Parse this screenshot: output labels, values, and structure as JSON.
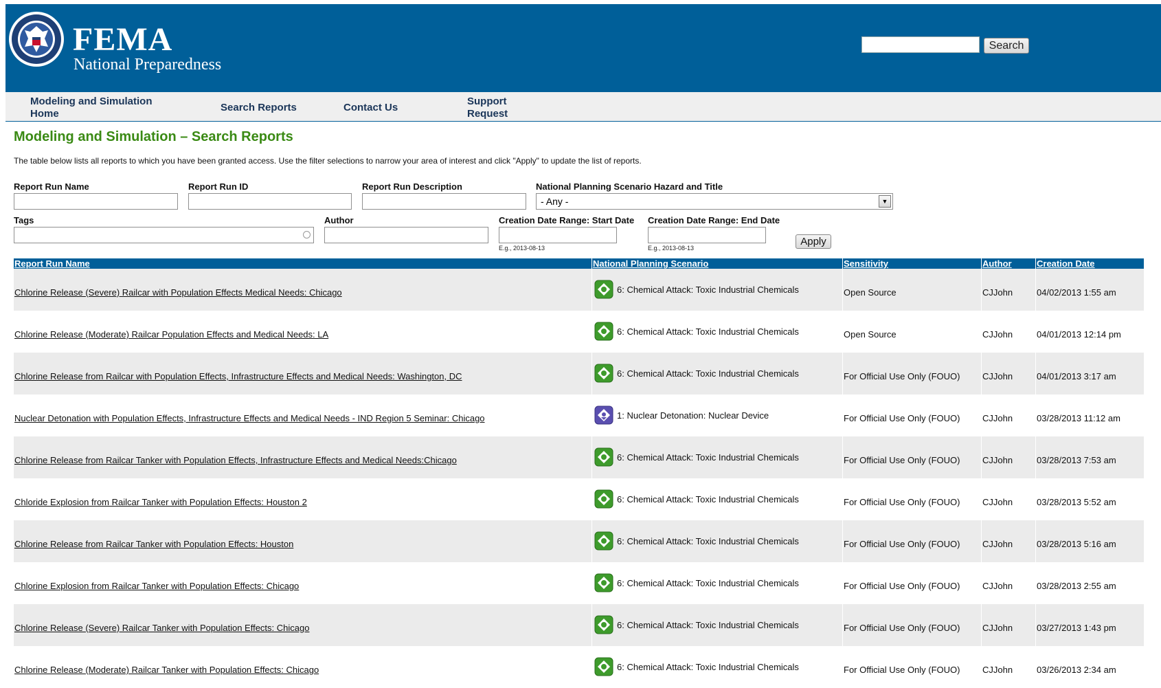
{
  "header": {
    "logo_title": "FEMA",
    "logo_subtitle": "National Preparedness",
    "search_button": "Search",
    "search_value": ""
  },
  "nav": {
    "items": [
      {
        "label": "Modeling and Simulation Home"
      },
      {
        "label": "Search Reports"
      },
      {
        "label": "Contact Us"
      },
      {
        "label": "Support Request"
      }
    ]
  },
  "page": {
    "title": "Modeling and Simulation – Search Reports",
    "intro": "The table below lists all reports to which you have been granted access. Use the filter selections to narrow your area of interest and click \"Apply\" to update the list of reports."
  },
  "filters": {
    "report_run_name": "Report Run Name",
    "report_run_id": "Report Run ID",
    "report_run_description": "Report Run Description",
    "hazard_label": "National Planning Scenario Hazard and Title",
    "hazard_selected": "- Any -",
    "tags": "Tags",
    "author": "Author",
    "start_date": "Creation Date Range: Start Date",
    "end_date": "Creation Date Range: End Date",
    "date_hint": "E.g., 2013-08-13",
    "apply": "Apply"
  },
  "colors": {
    "header_blue": "#005f99",
    "title_green": "#3a8a14",
    "chemical_icon": "#3e9b2c",
    "nuclear_icon": "#5a4fb0"
  },
  "table": {
    "headers": [
      "Report Run Name",
      "National Planning Scenario",
      "Sensitivity",
      "Author",
      "Creation Date"
    ],
    "rows": [
      {
        "name": "Chlorine Release (Severe) Railcar with Population Effects Medical Needs: Chicago",
        "icon": "chemical-hazard-icon",
        "scenario": "6: Chemical Attack: Toxic Industrial Chemicals",
        "sensitivity": "Open Source",
        "author": "CJJohn",
        "date": "04/02/2013 1:55 am"
      },
      {
        "name": "Chlorine Release (Moderate) Railcar Population Effects and Medical Needs: LA",
        "icon": "chemical-hazard-icon",
        "scenario": "6: Chemical Attack: Toxic Industrial Chemicals",
        "sensitivity": "Open Source",
        "author": "CJJohn",
        "date": "04/01/2013 12:14 pm"
      },
      {
        "name": "Chlorine Release from Railcar with Population Effects, Infrastructure Effects and Medical Needs: Washington, DC",
        "icon": "chemical-hazard-icon",
        "scenario": "6: Chemical Attack: Toxic Industrial Chemicals",
        "sensitivity": "For Official Use Only (FOUO)",
        "author": "CJJohn",
        "date": "04/01/2013 3:17 am"
      },
      {
        "name": "Nuclear Detonation with Population Effects, Infrastructure Effects and Medical Needs - IND Region 5 Seminar: Chicago",
        "icon": "nuclear-hazard-icon",
        "scenario": "1: Nuclear Detonation: Nuclear Device",
        "sensitivity": "For Official Use Only (FOUO)",
        "author": "CJJohn",
        "date": "03/28/2013 11:12 am"
      },
      {
        "name": "Chlorine Release from Railcar Tanker with Population Effects, Infrastructure Effects and Medical Needs:Chicago",
        "icon": "chemical-hazard-icon",
        "scenario": "6: Chemical Attack: Toxic Industrial Chemicals",
        "sensitivity": "For Official Use Only (FOUO)",
        "author": "CJJohn",
        "date": "03/28/2013 7:53 am"
      },
      {
        "name": "Chloride Explosion from Railcar Tanker with Population Effects: Houston 2",
        "icon": "chemical-hazard-icon",
        "scenario": "6: Chemical Attack: Toxic Industrial Chemicals",
        "sensitivity": "For Official Use Only (FOUO)",
        "author": "CJJohn",
        "date": "03/28/2013 5:52 am"
      },
      {
        "name": "Chlorine Release from Railcar Tanker with Population Effects: Houston",
        "icon": "chemical-hazard-icon",
        "scenario": "6: Chemical Attack: Toxic Industrial Chemicals",
        "sensitivity": "For Official Use Only (FOUO)",
        "author": "CJJohn",
        "date": "03/28/2013 5:16 am"
      },
      {
        "name": "Chlorine Explosion from Railcar Tanker with Population Effects: Chicago",
        "icon": "chemical-hazard-icon",
        "scenario": "6: Chemical Attack: Toxic Industrial Chemicals",
        "sensitivity": "For Official Use Only (FOUO)",
        "author": "CJJohn",
        "date": "03/28/2013 2:55 am"
      },
      {
        "name": "Chlorine Release (Severe) Railcar Tanker with Population Effects: Chicago",
        "icon": "chemical-hazard-icon",
        "scenario": "6: Chemical Attack: Toxic Industrial Chemicals",
        "sensitivity": "For Official Use Only (FOUO)",
        "author": "CJJohn",
        "date": "03/27/2013 1:43 pm"
      },
      {
        "name": "Chlorine Release (Moderate) Railcar Tanker with Population Effects: Chicago",
        "icon": "chemical-hazard-icon",
        "scenario": "6: Chemical Attack: Toxic Industrial Chemicals",
        "sensitivity": "For Official Use Only (FOUO)",
        "author": "CJJohn",
        "date": "03/26/2013 2:34 am"
      }
    ]
  }
}
